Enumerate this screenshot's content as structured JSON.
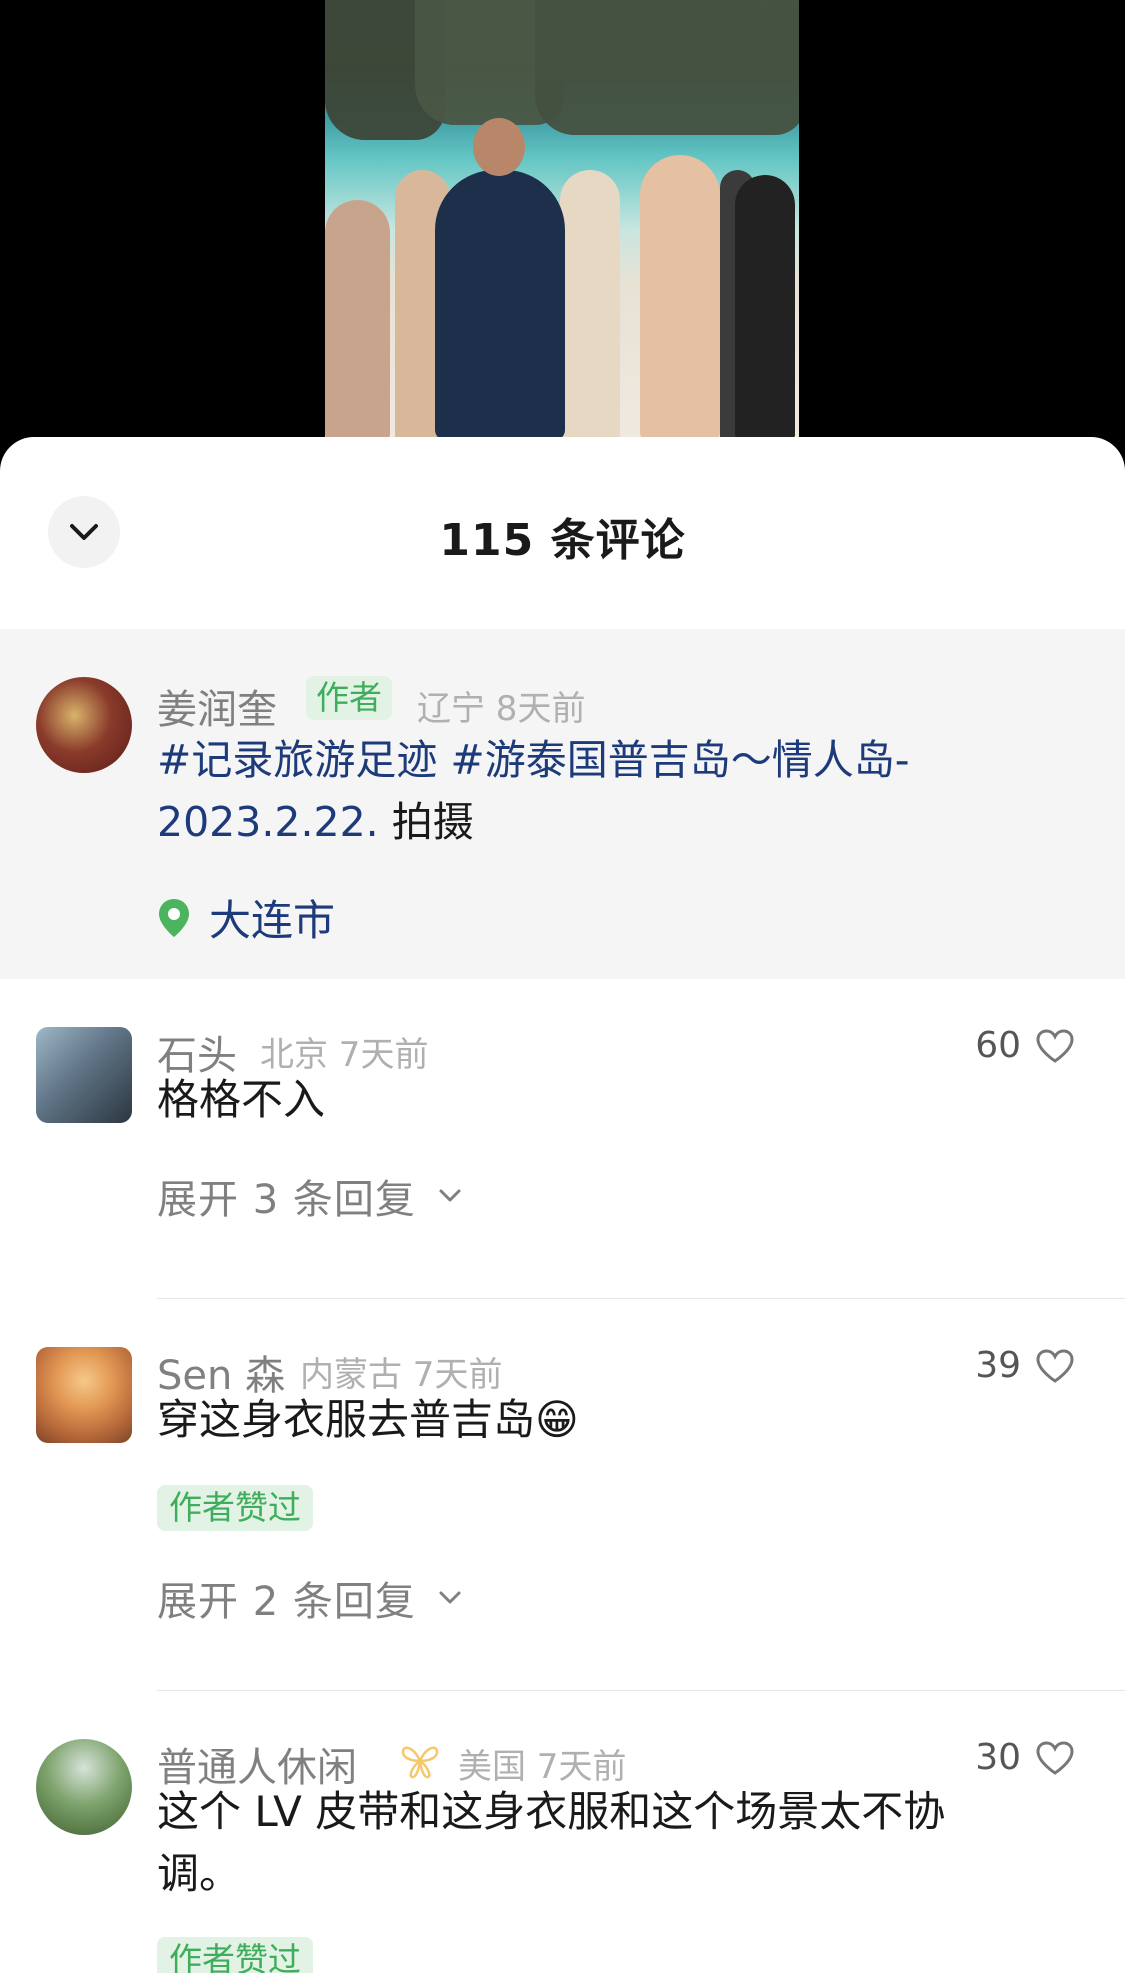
{
  "sheet": {
    "title": "115 条评论",
    "collapse_icon": "chevron-down-icon"
  },
  "author_post": {
    "name": "姜润奎",
    "tag": "作者",
    "meta": "辽宁 8天前",
    "text_line1": "#记录旅游足迹 #游泰国普吉岛～情人岛-",
    "text_line2_prefix": "2023.2.22.",
    "text_line2_suffix": " 拍摄",
    "location": "大连市"
  },
  "comments": [
    {
      "name": "石头",
      "meta": "北京 7天前",
      "text": "格格不入",
      "likes": "60",
      "expand": "展开 3 条回复"
    },
    {
      "name": "Sen 森",
      "meta": "内蒙古 7天前",
      "text": "穿这身衣服去普吉岛😁",
      "likes": "39",
      "badge": "作者赞过",
      "expand": "展开 2 条回复"
    },
    {
      "name": "普通人休闲",
      "meta": "美国 7天前",
      "text": "这个 LV 皮带和这身衣服和这个场景太不协调。",
      "likes": "30",
      "badge": "作者赞过"
    }
  ],
  "colors": {
    "accent_green": "#3fae5c",
    "link_blue": "#1d3a7a",
    "butterfly": "#f5c86a"
  }
}
